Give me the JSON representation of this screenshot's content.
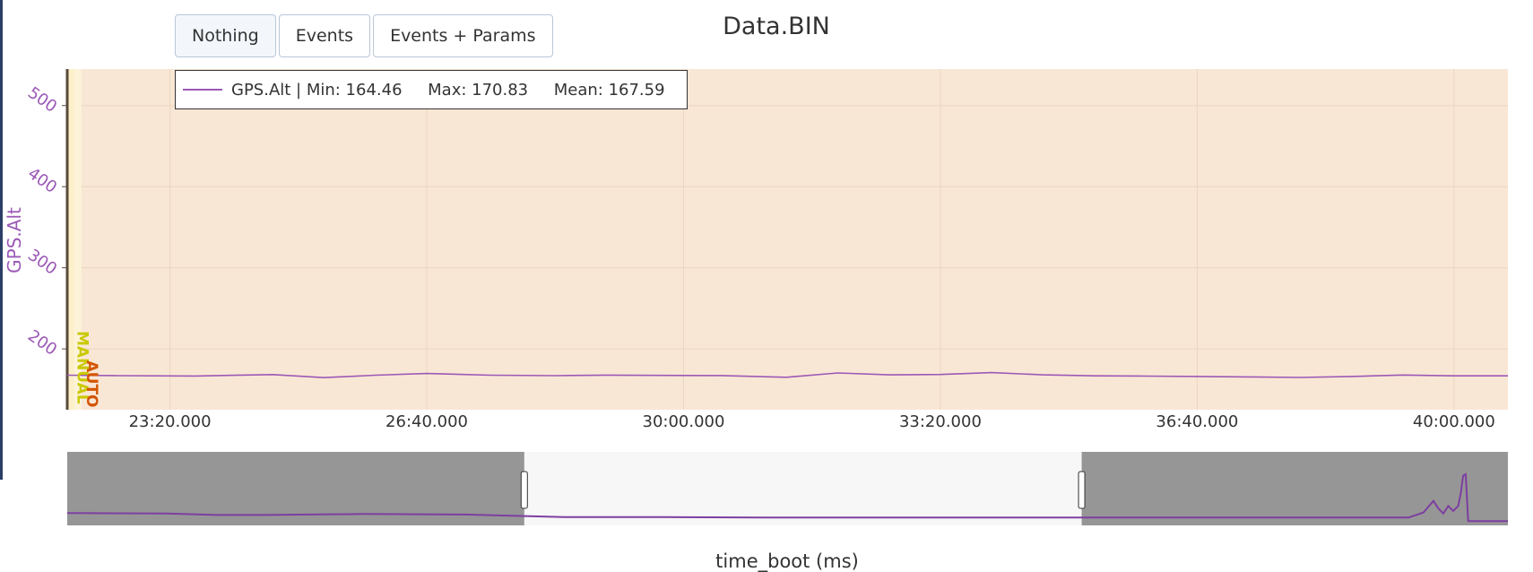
{
  "toolbar": {
    "buttons": [
      "Nothing",
      "Events",
      "Events + Params"
    ],
    "active": "Nothing"
  },
  "colors": {
    "series": "#9b59b6",
    "plot_bg": "#f9e7d5",
    "rangeslider_dim": "#969696",
    "rangeslider_window": "#f7f7f7",
    "mode_manual": "#c9c900",
    "mode_auto": "#d35400"
  },
  "chart_data": {
    "type": "line",
    "title": "Data.BIN",
    "xlabel": "time_boot (ms)",
    "ylabel": "GPS.Alt",
    "legend": {
      "placement": "top-left",
      "entry": "GPS.Alt | Min: 164.46     Max: 170.83     Mean: 167.59"
    },
    "x_ticks": [
      "23:20.000",
      "26:40.000",
      "30:00.000",
      "33:20.000",
      "36:40.000",
      "40:00.000"
    ],
    "y_ticks": [
      200,
      300,
      400,
      500
    ],
    "x_range_s": [
      1320,
      2442
    ],
    "ylim": [
      125,
      545
    ],
    "grid": true,
    "mode_markers": [
      {
        "label": "MANUAL",
        "x_s": 1324
      },
      {
        "label": "AUTO",
        "x_s": 1331
      }
    ],
    "series": [
      {
        "name": "GPS.Alt",
        "x_s": [
          1320,
          1360,
          1420,
          1480,
          1520,
          1560,
          1600,
          1650,
          1700,
          1740,
          1780,
          1830,
          1880,
          1920,
          1960,
          2000,
          2040,
          2080,
          2120,
          2160,
          2200,
          2240,
          2280,
          2320,
          2360,
          2400,
          2442
        ],
        "y": [
          167.5,
          167.0,
          166.6,
          168.3,
          164.6,
          167.5,
          169.6,
          167.5,
          167.0,
          167.7,
          167.3,
          167.1,
          165.0,
          170.3,
          168.0,
          168.4,
          170.8,
          168.0,
          166.8,
          166.5,
          166.0,
          165.5,
          164.8,
          166.0,
          167.8,
          166.8,
          166.8
        ]
      }
    ],
    "rangeslider": {
      "full_x_range_s": [
        400,
        3300
      ],
      "window_s": [
        1320,
        2442
      ],
      "overview": {
        "x_s": [
          400,
          600,
          700,
          800,
          1000,
          1200,
          1400,
          1600,
          1800,
          2000,
          2200,
          2400,
          2600,
          2800,
          3000,
          3100,
          3130,
          3150,
          3160,
          3170,
          3180,
          3190,
          3200,
          3205,
          3210,
          3215,
          3220,
          3230,
          3300
        ],
        "y": [
          0.21,
          0.2,
          0.17,
          0.17,
          0.19,
          0.18,
          0.13,
          0.13,
          0.12,
          0.12,
          0.12,
          0.12,
          0.12,
          0.12,
          0.12,
          0.12,
          0.22,
          0.45,
          0.3,
          0.2,
          0.35,
          0.25,
          0.35,
          0.6,
          0.95,
          0.98,
          0.05,
          0.05,
          0.05
        ]
      }
    }
  }
}
